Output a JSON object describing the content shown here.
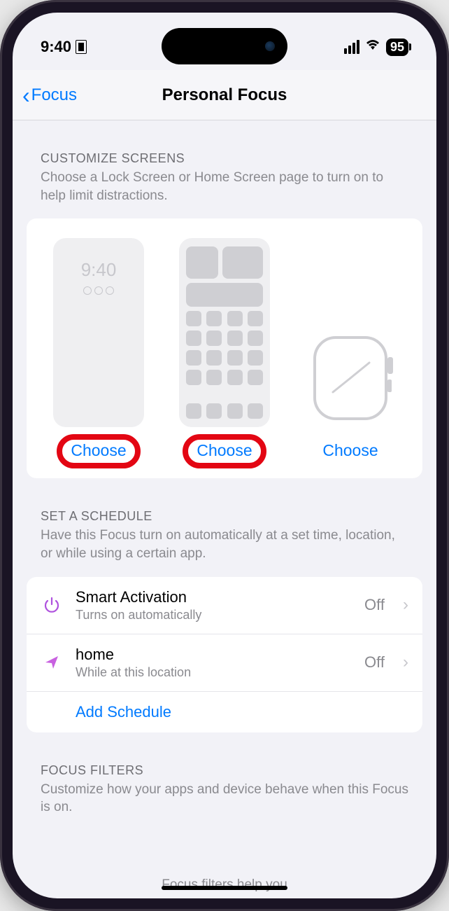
{
  "status": {
    "time": "9:40",
    "battery": "95"
  },
  "nav": {
    "back_label": "Focus",
    "title": "Personal Focus"
  },
  "customize": {
    "header": "CUSTOMIZE SCREENS",
    "desc": "Choose a Lock Screen or Home Screen page to turn on to help limit distractions.",
    "lock_time": "9:40",
    "choose_lock": "Choose",
    "choose_home": "Choose",
    "choose_watch": "Choose"
  },
  "schedule": {
    "header": "SET A SCHEDULE",
    "desc": "Have this Focus turn on automatically at a set time, location, or while using a certain app.",
    "smart_title": "Smart Activation",
    "smart_sub": "Turns on automatically",
    "smart_value": "Off",
    "home_title": "home",
    "home_sub": "While at this location",
    "home_value": "Off",
    "add_label": "Add Schedule"
  },
  "filters": {
    "header": "FOCUS FILTERS",
    "desc": "Customize how your apps and device behave when this Focus is on.",
    "peek": "Focus filters help you"
  }
}
